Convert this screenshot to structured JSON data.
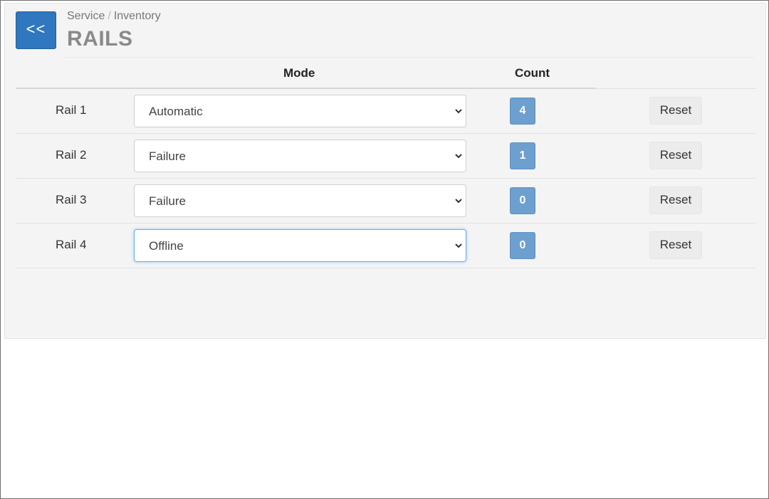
{
  "header": {
    "back_label": "<<",
    "breadcrumb": [
      "Service",
      "Inventory"
    ],
    "breadcrumb_separator": "/",
    "title": "RAILS"
  },
  "table": {
    "columns": {
      "mode": "Mode",
      "count": "Count"
    },
    "rows": [
      {
        "label": "Rail 1",
        "mode": "Automatic",
        "count": "4",
        "reset_label": "Reset"
      },
      {
        "label": "Rail 2",
        "mode": "Failure",
        "count": "1",
        "reset_label": "Reset"
      },
      {
        "label": "Rail 3",
        "mode": "Failure",
        "count": "0",
        "reset_label": "Reset"
      },
      {
        "label": "Rail 4",
        "mode": "Offline",
        "count": "0",
        "reset_label": "Reset",
        "focused": true
      }
    ]
  },
  "icons": {
    "select_arrow": "chevron-down-icon"
  },
  "colors": {
    "back_button": "#2f77be",
    "count_badge": "#6d9fcf",
    "focus_ring": "#66afe9",
    "panel_background": "#f4f4f4"
  }
}
